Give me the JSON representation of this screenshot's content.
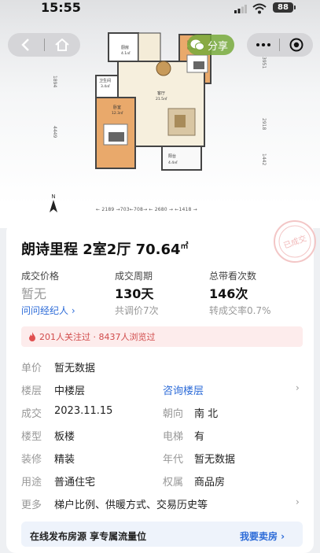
{
  "status_bar": {
    "time": "15:55",
    "battery": "88"
  },
  "nav": {
    "share_label": "分享"
  },
  "floorplan": {
    "rooms": {
      "kitchen": "厨房",
      "kitchen_area": "4.1㎡",
      "bedroom2": "卧室",
      "bedroom2_area": "9.8㎡",
      "bathroom": "卫生间",
      "bathroom_area": "3.4㎡",
      "living": "客厅",
      "living_area": "21.5㎡",
      "bedroom1": "卧室",
      "bedroom1_area": "12.3㎡",
      "balcony": "阳台",
      "balcony_area": "4.4㎡"
    },
    "left_dims": [
      "1894",
      "4449"
    ],
    "right_dims": [
      "3951",
      "2918",
      "1442"
    ],
    "bottom_dims": "← 2189 →703←708→ ← 2680 → ←1418 →",
    "north_label": "N"
  },
  "listing": {
    "stamp_text": "已成交",
    "title": "朗诗里程 2室2厅 70.64",
    "title_unit": "㎡",
    "stats": [
      {
        "label": "成交价格",
        "value": "暂无",
        "sub": "问问经纪人 ›"
      },
      {
        "label": "成交周期",
        "value": "130天",
        "sub": "共调价7次"
      },
      {
        "label": "总带看次数",
        "value": "146次",
        "sub": "转成交率0.7%"
      }
    ],
    "alert": "201人关注过 · 8437人浏览过",
    "details": {
      "unit_price_k": "单价",
      "unit_price_v": "暂无数据",
      "floor_k": "楼层",
      "floor_v": "中楼层",
      "floor_link": "咨询楼层",
      "deal_k": "成交",
      "deal_v": "2023.11.15",
      "orient_k": "朝向",
      "orient_v": "南 北",
      "btype_k": "楼型",
      "btype_v": "板楼",
      "elev_k": "电梯",
      "elev_v": "有",
      "decor_k": "装修",
      "decor_v": "精装",
      "year_k": "年代",
      "year_v": "暂无数据",
      "use_k": "用途",
      "use_v": "普通住宅",
      "own_k": "权属",
      "own_v": "商品房",
      "more_k": "更多",
      "more_v": "梯户比例、供暖方式、交易历史等"
    },
    "banner": {
      "text": "在线发布房源 享专属流量位",
      "action": "我要卖房 ›"
    }
  }
}
